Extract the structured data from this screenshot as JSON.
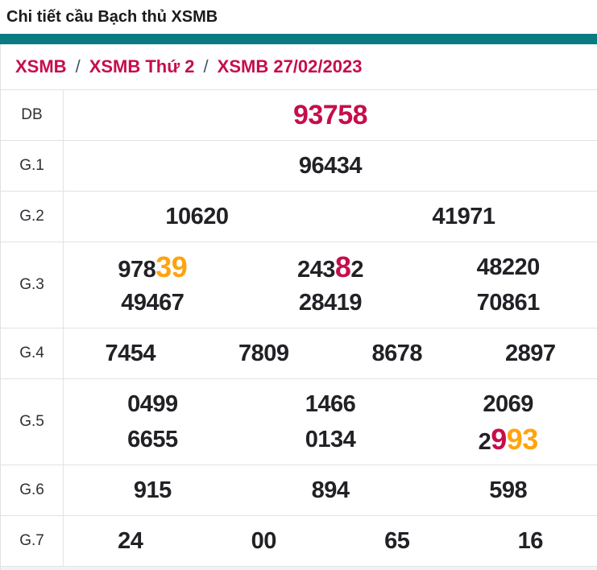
{
  "page": {
    "title": "Chi tiết cầu Bạch thủ XSMB"
  },
  "colors": {
    "accent_teal": "#0a7b81",
    "crimson": "#c60e4b",
    "orange": "#ffa40e",
    "text_dark": "#212126",
    "label_gray": "#2f2f36",
    "border_gray": "#e2e2e2",
    "strip_gray": "#f2f2f2"
  },
  "breadcrumb": {
    "separator": "/",
    "items": [
      {
        "label": "XSMB"
      },
      {
        "label": "XSMB Thứ 2"
      },
      {
        "label": "XSMB 27/02/2023"
      }
    ]
  },
  "results_table": {
    "rows": [
      {
        "id": "db",
        "label": "DB",
        "lines": [
          [
            {
              "segments": [
                {
                  "text": "93758",
                  "color": "jackpot"
                }
              ]
            }
          ]
        ]
      },
      {
        "id": "g1",
        "label": "G.1",
        "lines": [
          [
            {
              "segments": [
                {
                  "text": "96434"
                }
              ]
            }
          ]
        ]
      },
      {
        "id": "g2",
        "label": "G.2",
        "lines": [
          [
            {
              "segments": [
                {
                  "text": "10620"
                }
              ]
            },
            {
              "segments": [
                {
                  "text": "41971"
                }
              ]
            }
          ]
        ]
      },
      {
        "id": "g3",
        "label": "G.3",
        "lines": [
          [
            {
              "segments": [
                {
                  "text": "978"
                },
                {
                  "text": "39",
                  "color": "orange"
                }
              ]
            },
            {
              "segments": [
                {
                  "text": "243"
                },
                {
                  "text": "8",
                  "color": "crimson"
                },
                {
                  "text": "2"
                }
              ]
            },
            {
              "segments": [
                {
                  "text": "48220"
                }
              ]
            }
          ],
          [
            {
              "segments": [
                {
                  "text": "49467"
                }
              ]
            },
            {
              "segments": [
                {
                  "text": "28419"
                }
              ]
            },
            {
              "segments": [
                {
                  "text": "70861"
                }
              ]
            }
          ]
        ]
      },
      {
        "id": "g4",
        "label": "G.4",
        "lines": [
          [
            {
              "segments": [
                {
                  "text": "7454"
                }
              ]
            },
            {
              "segments": [
                {
                  "text": "7809"
                }
              ]
            },
            {
              "segments": [
                {
                  "text": "8678"
                }
              ]
            },
            {
              "segments": [
                {
                  "text": "2897"
                }
              ]
            }
          ]
        ]
      },
      {
        "id": "g5",
        "label": "G.5",
        "lines": [
          [
            {
              "segments": [
                {
                  "text": "0499"
                }
              ]
            },
            {
              "segments": [
                {
                  "text": "1466"
                }
              ]
            },
            {
              "segments": [
                {
                  "text": "2069"
                }
              ]
            }
          ],
          [
            {
              "segments": [
                {
                  "text": "6655"
                }
              ]
            },
            {
              "segments": [
                {
                  "text": "0134"
                }
              ]
            },
            {
              "segments": [
                {
                  "text": "2"
                },
                {
                  "text": "9",
                  "color": "crimson"
                },
                {
                  "text": "93",
                  "color": "orange"
                }
              ]
            }
          ]
        ]
      },
      {
        "id": "g6",
        "label": "G.6",
        "lines": [
          [
            {
              "segments": [
                {
                  "text": "915"
                }
              ]
            },
            {
              "segments": [
                {
                  "text": "894"
                }
              ]
            },
            {
              "segments": [
                {
                  "text": "598"
                }
              ]
            }
          ]
        ]
      },
      {
        "id": "g7",
        "label": "G.7",
        "lines": [
          [
            {
              "segments": [
                {
                  "text": "24"
                }
              ]
            },
            {
              "segments": [
                {
                  "text": "00"
                }
              ]
            },
            {
              "segments": [
                {
                  "text": "65"
                }
              ]
            },
            {
              "segments": [
                {
                  "text": "16"
                }
              ]
            }
          ]
        ]
      }
    ]
  }
}
